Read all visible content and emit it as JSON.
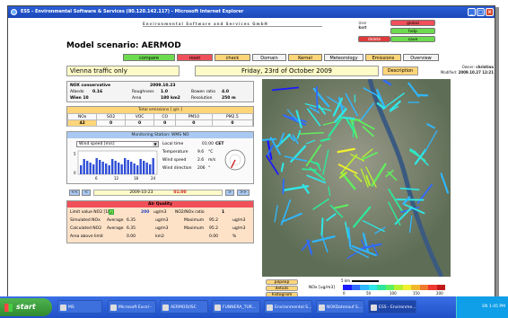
{
  "window": {
    "title": "ESS - Environmental Software & Services (80.120.142.117) - Microsoft Internet Explorer"
  },
  "header": {
    "subtitle": "Environmental Software and Services GmbH",
    "scenario_title": "Model scenario: AERMOD",
    "user_label": "User",
    "user_name": "ksrt",
    "right_buttons": {
      "global": "global",
      "help": "help",
      "delete": "delete",
      "save": "save"
    }
  },
  "toolbar": {
    "buttons": [
      "compare",
      "reset",
      "check",
      "Domain",
      "Kernel",
      "Meteorology",
      "Emissions",
      "Overview"
    ]
  },
  "infobar": {
    "location": "Vienna traffic only",
    "date": "Friday, 23rd of October 2009",
    "description_button": "Description",
    "owner_label": "Owner:",
    "owner": "christina",
    "modified_label": "Modified:",
    "modified": "2009.10.27 12:21"
  },
  "params": {
    "name": "NOX conservative",
    "date": "2009.10.23",
    "albedo_label": "Albedo",
    "albedo": "0.16",
    "roughness_label": "Roughness",
    "roughness": "1.0",
    "bowen_label": "Bowen ratio",
    "bowen": "4.0",
    "source": "Wien 10",
    "area_label": "Area",
    "area": "180 km2",
    "resolution_label": "Resolution",
    "resolution": "250 m"
  },
  "emissions": {
    "title": "Total emissions [ g/s ]",
    "columns": [
      "NOx",
      "SO2",
      "VOC",
      "CO",
      "PM10",
      "PM2.5"
    ],
    "values": [
      "42",
      "0",
      "0",
      "0",
      "0",
      "0"
    ]
  },
  "station": {
    "title": "Monitoring Station: WMS NO",
    "select_value": "Wind speed [m/s]",
    "local_time_label": "Local time",
    "local_time": "01:00",
    "timezone": "CET",
    "temperature_label": "Temperature",
    "temperature": "9.6",
    "temperature_unit": "°C",
    "wind_speed_label": "Wind speed",
    "wind_speed": "2.6",
    "wind_speed_unit": "m/s",
    "wind_dir_label": "Wind direction",
    "wind_dir": "206",
    "wind_dir_unit": "°",
    "x_ticks": [
      "6",
      "12",
      "18",
      "24"
    ],
    "y_ticks": [
      "5",
      "0"
    ]
  },
  "nav": {
    "first": "<<",
    "prev": "<",
    "date": "2009-10-23",
    "time": "01:00",
    "next": ">",
    "last": ">>"
  },
  "air_quality": {
    "title": "Air Quality",
    "limit_label": "Limit value NO2 [1h]",
    "limit_value": "200",
    "limit_unit": "ug/m3",
    "ratio_label": "NO2/NOx ratio",
    "ratio_value": "1",
    "rows": [
      {
        "label": "Simulated NOx",
        "avg_label": "Average",
        "avg": "6.35",
        "unit1": "ug/m3",
        "max_label": "Maximum",
        "max": "95.2",
        "unit2": "ug/m3"
      },
      {
        "label": "Calculated NO2",
        "avg_label": "Average",
        "avg": "6.35",
        "unit1": "ug/m3",
        "max_label": "Maximum",
        "max": "95.2",
        "unit2": "ug/m3"
      }
    ],
    "area_label": "Area above limit",
    "area_value": "0.00",
    "area_unit": "km2",
    "pct_value": "0.00",
    "pct_unit": "%"
  },
  "map_legend": {
    "buttons": [
      "popexp",
      "details",
      "histogram"
    ],
    "scale_label": "5 km",
    "units": "NOx [ug/m3]",
    "ticks": [
      "0",
      "50",
      "100",
      "150",
      "200"
    ],
    "colors": [
      "#1a1aff",
      "#2f6bff",
      "#2fb7ff",
      "#2fe7e7",
      "#2fe79a",
      "#5ff05f",
      "#b7f02f",
      "#f0f02f",
      "#f0b72f",
      "#f07a2f",
      "#f03a2f",
      "#c01a1a"
    ]
  },
  "taskbar": {
    "start": "start",
    "tasks": [
      "MS",
      "Microsoft Excel -",
      "AERMOD/ISC",
      "FUNNERA_TUR...",
      "Environmental S...",
      "NOXDatenauf S...",
      "ESS - Environme..."
    ],
    "tray": "EN  1:45 PM"
  }
}
